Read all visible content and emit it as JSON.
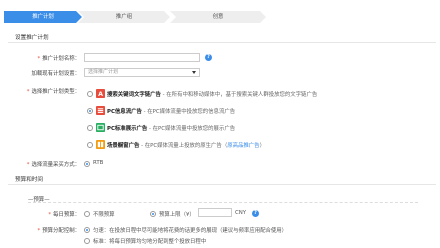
{
  "steps": [
    "推广计划",
    "推广组",
    "创意"
  ],
  "section_plan": "设置推广计划",
  "plan_name": {
    "label": "推广计划名称：",
    "value": ""
  },
  "load_existing": {
    "label": "加载现有计划设置：",
    "placeholder": "选择推广计划"
  },
  "ad_type": {
    "label": "选择推广计划类型：",
    "options": [
      {
        "title": "搜索关键词文字链广告",
        "desc": " - 在所有中和移动媒体中，基于搜索关键人群投放您的文字链广告",
        "icon_color": "#e74c3c",
        "selected": false
      },
      {
        "title": "PC信息流广告",
        "desc": " - 在PC媒体流量中投放您的信息流广告",
        "icon_color": "#e74c3c",
        "selected": true
      },
      {
        "title": "PC标准展示广告",
        "desc": " - 在PC媒体流量中投放您的展示广告",
        "icon_color": "#27ae60",
        "selected": false
      },
      {
        "title": "场景橱窗广告",
        "desc": " - 在PC媒体流量上投放的原生广告（",
        "link": "原高品推广告",
        "tail": "）",
        "icon_color": "#f39c12",
        "selected": false
      }
    ]
  },
  "settlement": {
    "label": "选择流量采买方式：",
    "value": "RTB"
  },
  "section_budget": "预算和时间",
  "budget_group": "预算",
  "daily_budget": {
    "label": "每日预算：",
    "opt_unlimited": "不限预算",
    "opt_limit": "预算上限（¥）",
    "currency": "CNY"
  },
  "budget_control": {
    "label": "预算分配控制：",
    "opt1": "匀速：在投放日程中尽可能地将花费的话更多的展现（建议与频率应用配合使用）",
    "opt2": "标准：将每日预算均匀地分配到整个投放日程中"
  }
}
